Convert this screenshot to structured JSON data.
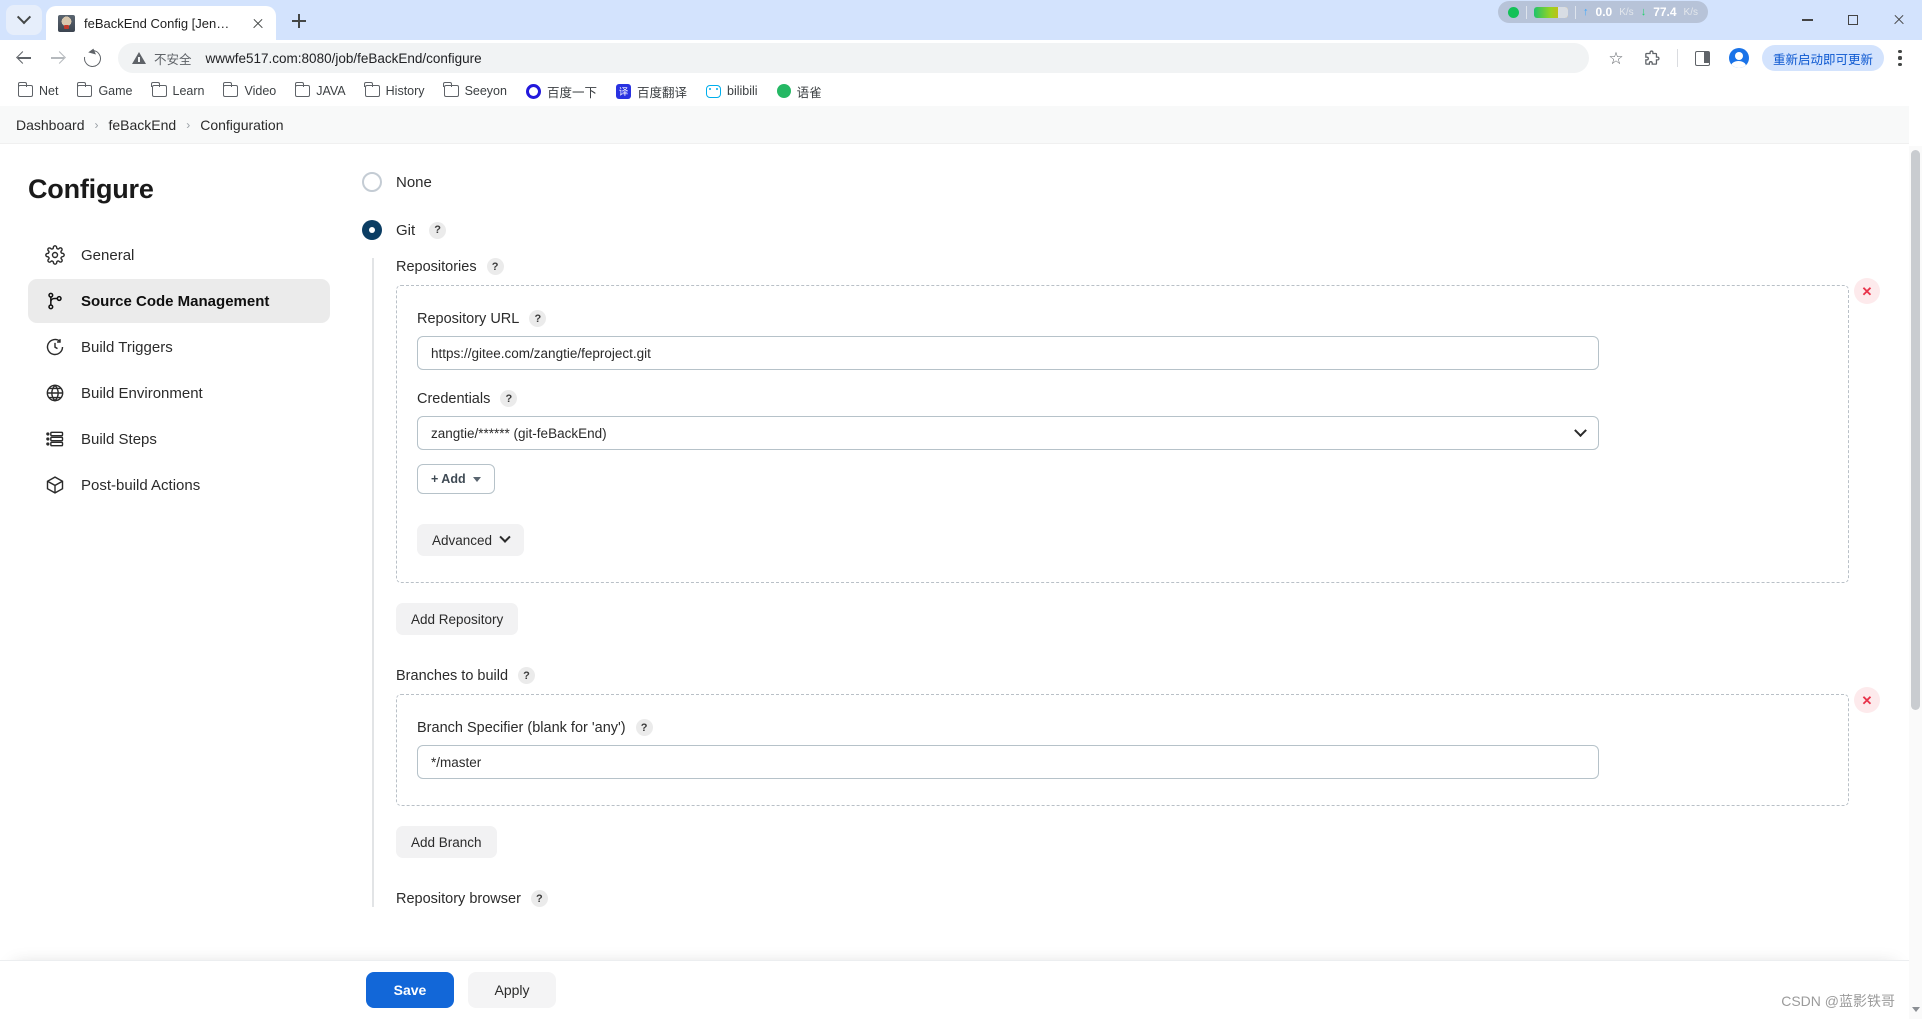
{
  "browser": {
    "tab": {
      "title": "feBackEnd Config [Jenkins]",
      "favicon": "jenkins-icon"
    },
    "tab_list_icon": "chevron-down-icon",
    "new_tab_icon": "plus-icon",
    "close_tab_icon": "close-icon",
    "nav": {
      "back_icon": "arrow-left-icon",
      "forward_icon": "arrow-right-icon",
      "reload_icon": "reload-icon"
    },
    "omnibox": {
      "security_icon": "warning-triangle-icon",
      "security_text": "不安全",
      "url": "wwwfe517.com:8080/job/feBackEnd/configure"
    },
    "actions": {
      "bookmark_icon": "star-icon",
      "extensions_icon": "puzzle-piece-icon",
      "side_panel_icon": "side-panel-icon",
      "profile_icon": "avatar-icon",
      "update_label": "重新启动即可更新",
      "menu_icon": "kebab-menu-icon"
    },
    "window": {
      "minimize_icon": "minimize-icon",
      "maximize_icon": "maximize-icon",
      "close_icon": "window-close-icon"
    },
    "net_speed": {
      "status_icon": "green-dot-icon",
      "meter_icon": "gauge-icon",
      "upload_arrow": "arrow-up-icon",
      "upload_value": "0.0",
      "upload_unit": "K/s",
      "download_arrow": "arrow-down-icon",
      "download_value": "77.4",
      "download_unit": "K/s"
    },
    "bookmarks": [
      {
        "label": "Net",
        "icon": "folder-icon"
      },
      {
        "label": "Game",
        "icon": "folder-icon"
      },
      {
        "label": "Learn",
        "icon": "folder-icon"
      },
      {
        "label": "Video",
        "icon": "folder-icon"
      },
      {
        "label": "JAVA",
        "icon": "folder-icon"
      },
      {
        "label": "History",
        "icon": "folder-icon"
      },
      {
        "label": "Seeyon",
        "icon": "folder-icon"
      },
      {
        "label": "百度一下",
        "icon": "baidu-icon"
      },
      {
        "label": "百度翻译",
        "icon": "fanyi-icon"
      },
      {
        "label": "bilibili",
        "icon": "bilibili-icon"
      },
      {
        "label": "语雀",
        "icon": "yuque-icon"
      }
    ]
  },
  "breadcrumb": [
    {
      "label": "Dashboard"
    },
    {
      "label": "feBackEnd"
    },
    {
      "label": "Configuration"
    }
  ],
  "breadcrumb_separator": "›",
  "sidebar": {
    "title": "Configure",
    "items": [
      {
        "label": "General",
        "icon": "gear-icon",
        "active": false
      },
      {
        "label": "Source Code Management",
        "icon": "git-branch-icon",
        "active": true
      },
      {
        "label": "Build Triggers",
        "icon": "clock-icon",
        "active": false
      },
      {
        "label": "Build Environment",
        "icon": "globe-icon",
        "active": false
      },
      {
        "label": "Build Steps",
        "icon": "list-icon",
        "active": false
      },
      {
        "label": "Post-build Actions",
        "icon": "package-icon",
        "active": false
      }
    ]
  },
  "scm": {
    "help_glyph": "?",
    "options": [
      {
        "label": "None",
        "selected": false,
        "has_help": false
      },
      {
        "label": "Git",
        "selected": true,
        "has_help": true
      }
    ],
    "repositories_label": "Repositories",
    "repository": {
      "url_label": "Repository URL",
      "url_value": "https://gitee.com/zangtie/feproject.git",
      "credentials_label": "Credentials",
      "credentials_value": "zangtie/****** (git-feBackEnd)",
      "credentials_chevron": "chevron-down-icon",
      "add_credentials_label": "+ Add",
      "advanced_label": "Advanced",
      "advanced_chevron": "chevron-down-icon",
      "delete_icon": "delete-x-icon"
    },
    "add_repository_label": "Add Repository",
    "branches_label": "Branches to build",
    "branch": {
      "specifier_label": "Branch Specifier (blank for 'any')",
      "specifier_value": "*/master",
      "delete_icon": "delete-x-icon"
    },
    "add_branch_label": "Add Branch",
    "repository_browser_label": "Repository browser"
  },
  "footer": {
    "save_label": "Save",
    "apply_label": "Apply"
  },
  "watermark": "CSDN @蓝影铁哥",
  "colors": {
    "accent": "#1267d8",
    "radio_selected": "#0b3d63",
    "danger": "#e8334a",
    "tabstrip": "#d3e3fd"
  }
}
